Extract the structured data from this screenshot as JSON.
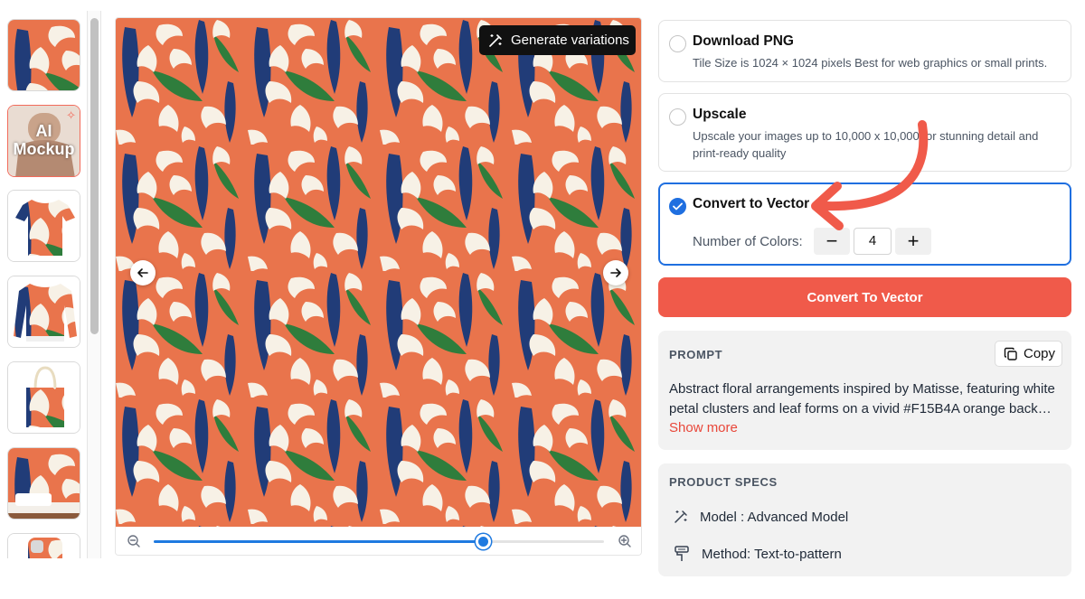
{
  "thumbnails": {
    "ai_mockup_label_line1": "AI",
    "ai_mockup_label_line2": "Mockup"
  },
  "preview": {
    "generate_variations_label": "Generate variations",
    "zoom_level_fraction": 0.73
  },
  "options": {
    "download": {
      "title": "Download PNG",
      "description": "Tile Size is 1024 × 1024 pixels Best for web graphics or small prints."
    },
    "upscale": {
      "title": "Upscale",
      "description": "Upscale your images up to 10,000 x 10,000 for stunning detail and print-ready quality"
    },
    "vector": {
      "title": "Convert to Vector",
      "colors_label": "Number of Colors:",
      "colors_value": "4",
      "minus_glyph": "−",
      "plus_glyph": "+"
    }
  },
  "cta": {
    "label": "Convert To Vector"
  },
  "prompt": {
    "section_label": "PROMPT",
    "copy_label": "Copy",
    "line1": "Abstract floral arrangements inspired by Matisse, featuring white",
    "line2": "petal clusters and leaf forms on a vivid #F15B4A orange backgrou…",
    "show_more": "Show more"
  },
  "specs": {
    "section_label": "PRODUCT SPECS",
    "model": "Model : Advanced Model",
    "method": "Method: Text-to-pattern"
  },
  "colors": {
    "pattern_bg": "#E9744C",
    "petal": "#F7F1E6",
    "navy": "#213C78",
    "leaf": "#2F7D3C",
    "accent_red": "#F05A4A",
    "selected_blue": "#1F6FE0"
  },
  "icons": {
    "generate": "magic-wand-icon",
    "prev": "arrow-left-icon",
    "next": "arrow-right-icon",
    "zoom_out": "zoom-out-icon",
    "zoom_in": "zoom-in-icon",
    "copy": "copy-icon",
    "model": "magic-wand-icon",
    "method": "paint-roller-icon"
  }
}
